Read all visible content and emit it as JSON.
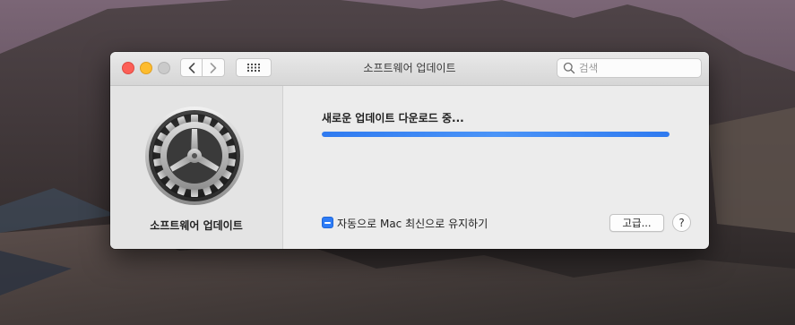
{
  "window": {
    "title": "소프트웨어 업데이트"
  },
  "toolbar": {
    "back_icon": "chevron-left-icon",
    "forward_icon": "chevron-right-icon",
    "grid_icon": "grid-icon"
  },
  "search": {
    "placeholder": "검색"
  },
  "sidebar": {
    "icon": "gear-icon",
    "label": "소프트웨어 업데이트"
  },
  "main": {
    "status": "새로운 업데이트 다운로드 중...",
    "progress": 1.0,
    "auto_update_label": "자동으로 Mac 최신으로 유지하기",
    "auto_update_state": "mixed",
    "advanced_button": "고급...",
    "help_button": "?"
  },
  "colors": {
    "accent": "#2e7cf6",
    "close": "#fc5f57",
    "minimize": "#fdbc2e",
    "zoom": "#cacaca"
  }
}
